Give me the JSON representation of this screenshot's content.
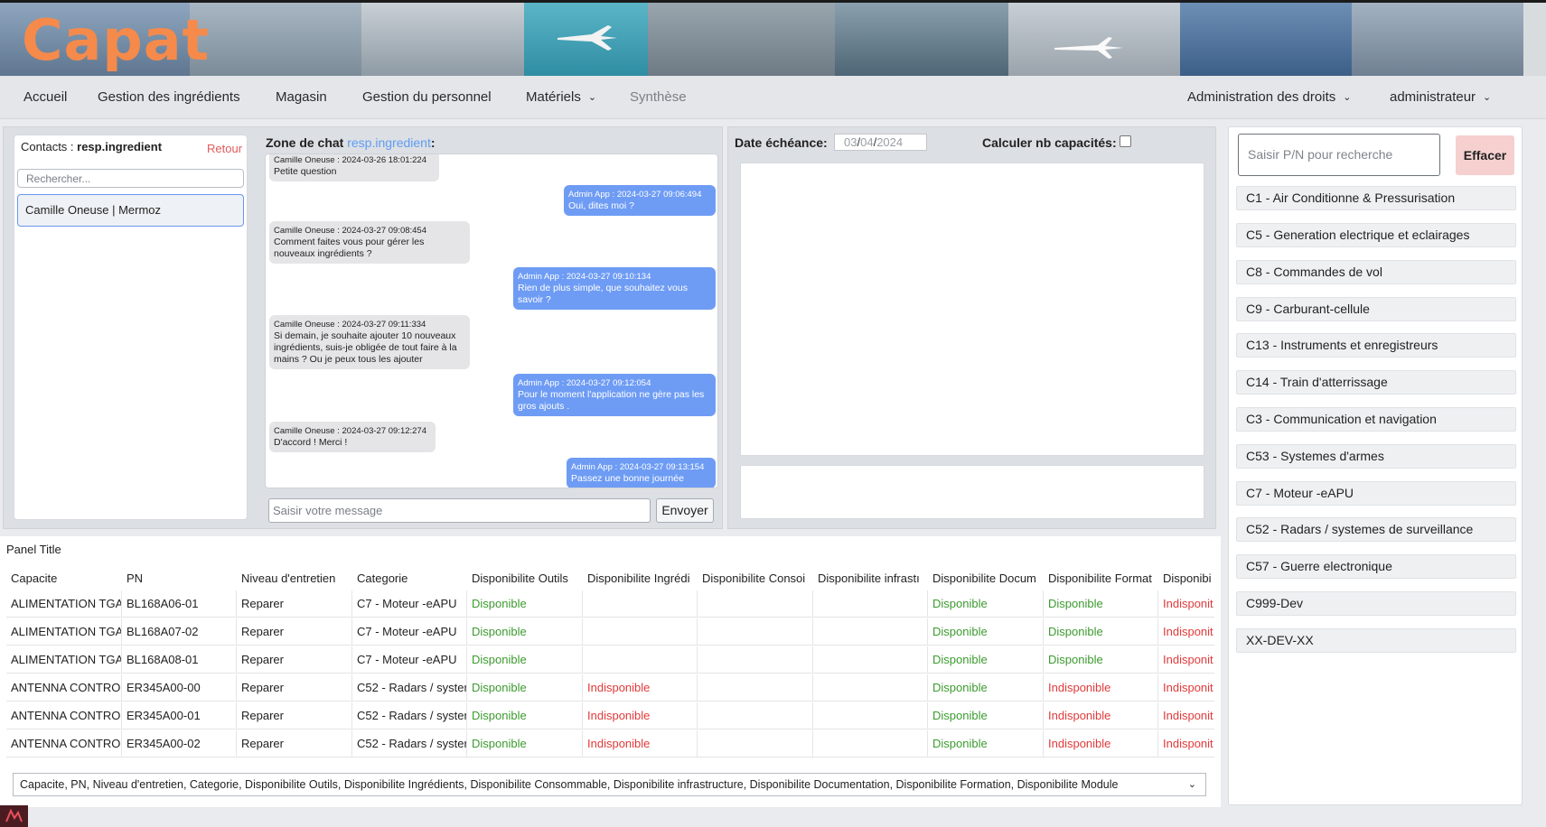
{
  "brand": "Capat",
  "nav": {
    "accueil": "Accueil",
    "ingredients": "Gestion des ingrédients",
    "magasin": "Magasin",
    "personnel": "Gestion du personnel",
    "materiels": "Matériels",
    "synthese": "Synthèse",
    "admin_droits": "Administration des droits",
    "user": "administrateur"
  },
  "contacts": {
    "label": "Contacts : ",
    "user": "resp.ingredient",
    "retour": "Retour",
    "search_placeholder": "Rechercher...",
    "items": [
      "Camille Oneuse | Mermoz"
    ]
  },
  "chat": {
    "title": "Zone de chat ",
    "user": "resp.ingredient",
    "colon": ":",
    "messages": [
      {
        "dir": "in",
        "meta": "Camille Oneuse : 2024-03-26 18:01:224",
        "text": "Petite question"
      },
      {
        "dir": "out",
        "meta": "Admin App : 2024-03-27 09:06:494",
        "text": "Oui, dites moi ?"
      },
      {
        "dir": "in",
        "meta": "Camille Oneuse : 2024-03-27 09:08:454",
        "text": "Comment faites vous pour gérer les nouveaux ingrédients ?"
      },
      {
        "dir": "out",
        "meta": "Admin App : 2024-03-27 09:10:134",
        "text": "Rien de plus simple, que souhaitez vous savoir ?"
      },
      {
        "dir": "in",
        "meta": "Camille Oneuse : 2024-03-27 09:11:334",
        "text": "Si demain, je souhaite ajouter 10 nouveaux ingrédients, suis-je obligée de tout faire à la mains ? Ou je peux tous les ajouter"
      },
      {
        "dir": "out",
        "meta": "Admin App : 2024-03-27 09:12:054",
        "text": "Pour le moment l'application ne gère pas les gros ajouts ."
      },
      {
        "dir": "in",
        "meta": "Camille Oneuse : 2024-03-27 09:12:274",
        "text": "D'accord ! Merci !"
      },
      {
        "dir": "out",
        "meta": "Admin App : 2024-03-27 09:13:154",
        "text": "Passez une bonne journée"
      }
    ],
    "input_placeholder": "Saisir votre message",
    "send_label": "Envoyer"
  },
  "echeance": {
    "label": "Date échéance:",
    "day": "03",
    "month": "04",
    "year": "2024",
    "calc_label": "Calculer nb capacités:",
    "calc_checked": false
  },
  "table": {
    "panel_title": "Panel Title",
    "headers": [
      "Capacite",
      "PN",
      "Niveau d'entretien",
      "Categorie",
      "Disponibilite Outils",
      "Disponibilite Ingrédi",
      "Disponibilite Consoi",
      "Disponibilite infrastı",
      "Disponibilite Docum",
      "Disponibilite Format",
      "Disponibi"
    ],
    "rows": [
      [
        "ALIMENTATION TGA",
        "BL168A06-01",
        "Reparer",
        "C7 - Moteur -eAPU",
        "Disponible",
        "",
        "",
        "",
        "Disponible",
        "Disponible",
        "Indisponit"
      ],
      [
        "ALIMENTATION TGA",
        "BL168A07-02",
        "Reparer",
        "C7 - Moteur -eAPU",
        "Disponible",
        "",
        "",
        "",
        "Disponible",
        "Disponible",
        "Indisponit"
      ],
      [
        "ALIMENTATION TGA",
        "BL168A08-01",
        "Reparer",
        "C7 - Moteur -eAPU",
        "Disponible",
        "",
        "",
        "",
        "Disponible",
        "Disponible",
        "Indisponit"
      ],
      [
        "ANTENNA CONTROL",
        "ER345A00-00",
        "Reparer",
        "C52 - Radars / syster",
        "Disponible",
        "Indisponible",
        "",
        "",
        "Disponible",
        "Indisponible",
        "Indisponit"
      ],
      [
        "ANTENNA CONTROL",
        "ER345A00-01",
        "Reparer",
        "C52 - Radars / syster",
        "Disponible",
        "Indisponible",
        "",
        "",
        "Disponible",
        "Indisponible",
        "Indisponit"
      ],
      [
        "ANTENNA CONTROL",
        "ER345A00-02",
        "Reparer",
        "C52 - Radars / syster",
        "Disponible",
        "Indisponible",
        "",
        "",
        "Disponible",
        "Indisponible",
        "Indisponit"
      ]
    ],
    "columns_select": "Capacite, PN, Niveau d'entretien, Categorie, Disponibilite Outils, Disponibilite Ingrédients, Disponibilite Consommable, Disponibilite infrastructure, Disponibilite Documentation, Disponibilite Formation, Disponibilite Module"
  },
  "right": {
    "search_placeholder": "Saisir P/N pour recherche",
    "clear_label": "Effacer",
    "items": [
      "C1 - Air Conditionne & Pressurisation",
      "C5 - Generation electrique et eclairages",
      "C8 - Commandes de vol",
      "C9 - Carburant-cellule",
      "C13 - Instruments et enregistreurs",
      "C14 - Train d'atterrissage",
      "C3 - Communication et navigation",
      "C53 - Systemes d'armes",
      "C7 - Moteur -eAPU",
      "C52 - Radars / systemes de surveillance",
      "C57 - Guerre electronique",
      "C999-Dev",
      "XX-DEV-XX"
    ]
  },
  "colors": {
    "brand": "#f58a4b",
    "available": "#3c9a2f",
    "unavailable": "#e13a3a",
    "chat_out": "#6e9cf4",
    "clear_button": "#f6cfcf"
  }
}
